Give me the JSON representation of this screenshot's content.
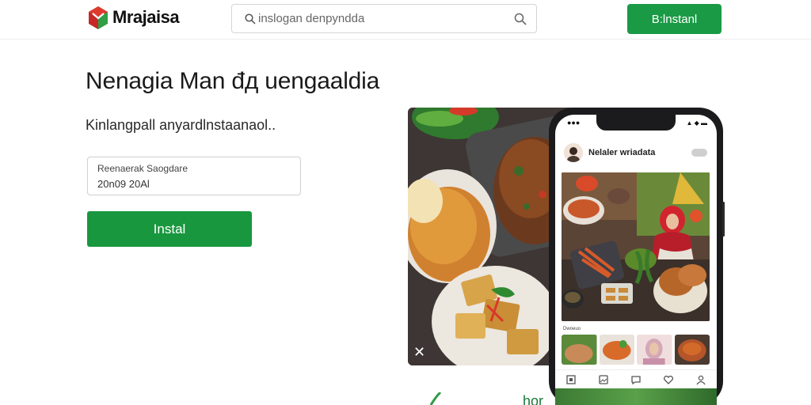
{
  "header": {
    "brand": "Mrajaisa",
    "search_placeholder": "inslogan denpyndda",
    "install_label": "B:lnstanl"
  },
  "hero": {
    "title": "Nenagia Man đд uengaaldia",
    "subtitle": "Kinlangpall anyardlnstaanaol..",
    "field_label": "Reenaerak Saogdare",
    "field_value": "20n09 20Al",
    "install_label": "Instal"
  },
  "phone": {
    "app_title": "Nelaler wriadata",
    "thumbs_label": "Dwoeuo"
  },
  "bottom_fragment": "hor",
  "colors": {
    "accent_green": "#1a9a45",
    "brand_red": "#d9322b"
  },
  "icons": [
    "logo-icon",
    "search-icon",
    "close-icon",
    "home-icon",
    "gallery-icon",
    "chat-icon",
    "heart-icon",
    "profile-icon"
  ]
}
